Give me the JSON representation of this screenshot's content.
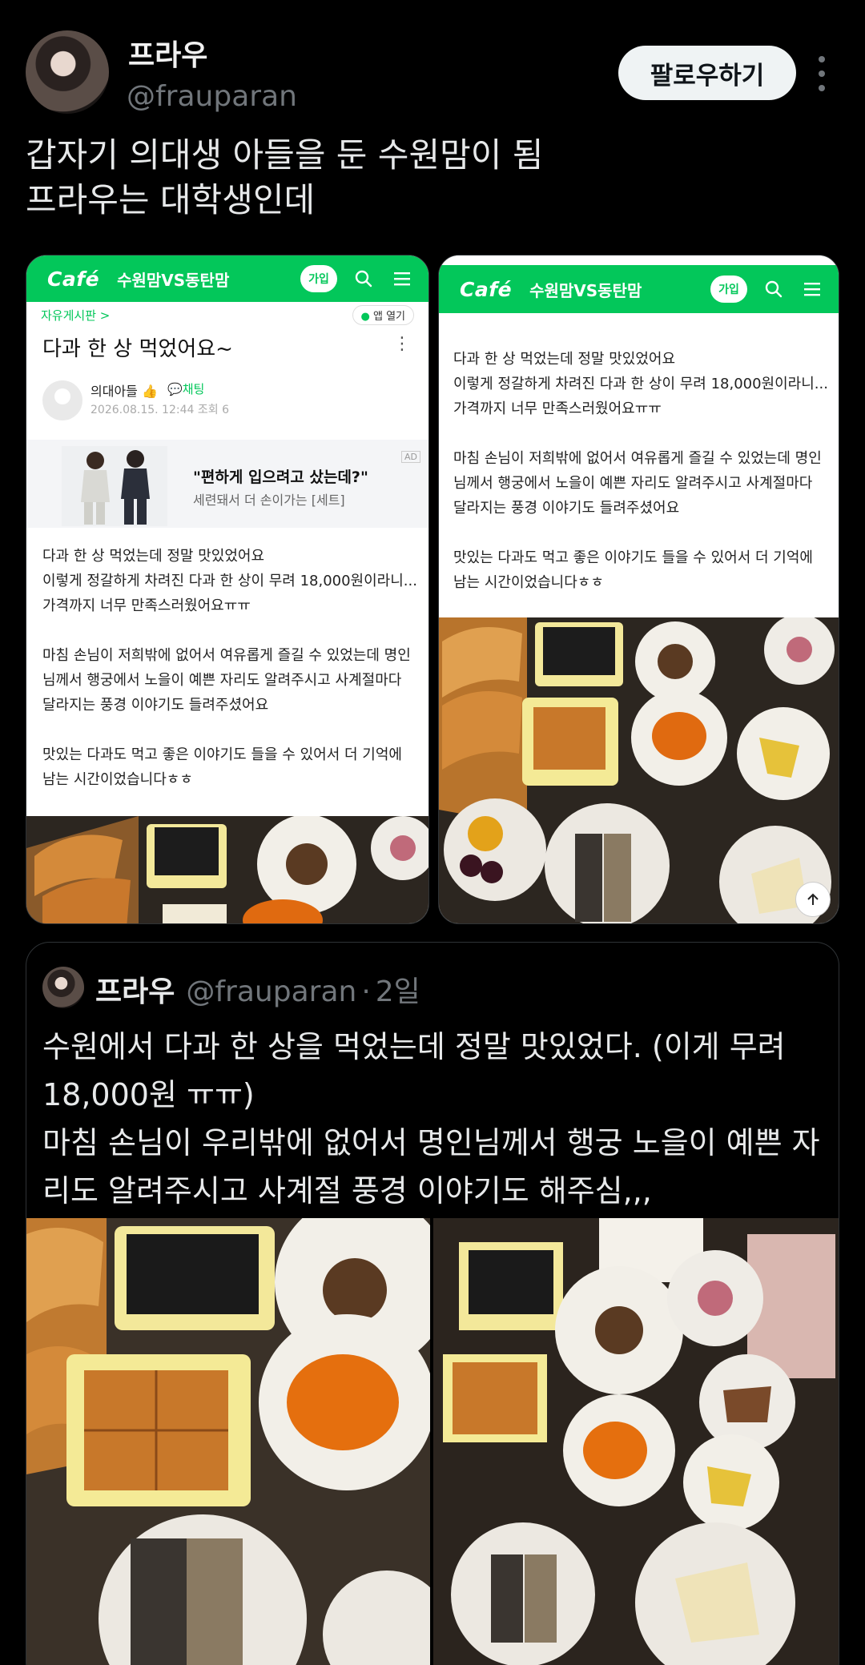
{
  "author": {
    "name": "프라우",
    "handle": "@frauparan",
    "avatar_icon": "profile-photo-icon"
  },
  "follow_label": "팔로우하기",
  "tweet_text": "갑자기 의대생 아들을 둔 수원맘이 됨\n프라우는 대학생인데",
  "cafe": {
    "logo": "Café",
    "name": "수원맘VS동탄맘",
    "join_label": "가입",
    "brand_color": "#03c75a"
  },
  "post": {
    "board": "자유게시판 >",
    "app_open": "앱 열기",
    "title": "다과 한 상 먹었어요~",
    "author": "의대아들",
    "chat": "채팅",
    "meta": "2026.08.15. 12:44  조회 6",
    "body": "다과 한 상 먹었는데 정말 맛있었어요\n이렇게 정갈하게 차려진 다과 한 상이 무려 18,000원이라니... 가격까지 너무 만족스러웠어요ㅠㅠ\n\n마침 손님이 저희밖에 없어서 여유롭게 즐길 수 있었는데 명인님께서 행궁에서 노을이 예쁜 자리도 알려주시고 사계절마다 달라지는 풍경 이야기도 들려주셨어요\n\n맛있는 다과도 먹고 좋은 이야기도 들을 수 있어서 더 기억에 남는 시간이었습니다ㅎㅎ"
  },
  "ad": {
    "headline": "\"편하게 입으려고 샀는데?\"",
    "sub": "세련돼서 더 손이가는 [세트]",
    "tag": "AD"
  },
  "quote": {
    "name": "프라우",
    "handle": "@frauparan",
    "dot": "·",
    "time": "2일",
    "text": "수원에서 다과 한 상을 먹었는데 정말 맛있었다. (이게 무려 18,000원 ㅠㅠ)\n마침 손님이 우리밖에 없어서 명인님께서 행궁 노을이 예쁜 자리도 알려주시고 사계절 풍경 이야기도 해주심,,,"
  }
}
